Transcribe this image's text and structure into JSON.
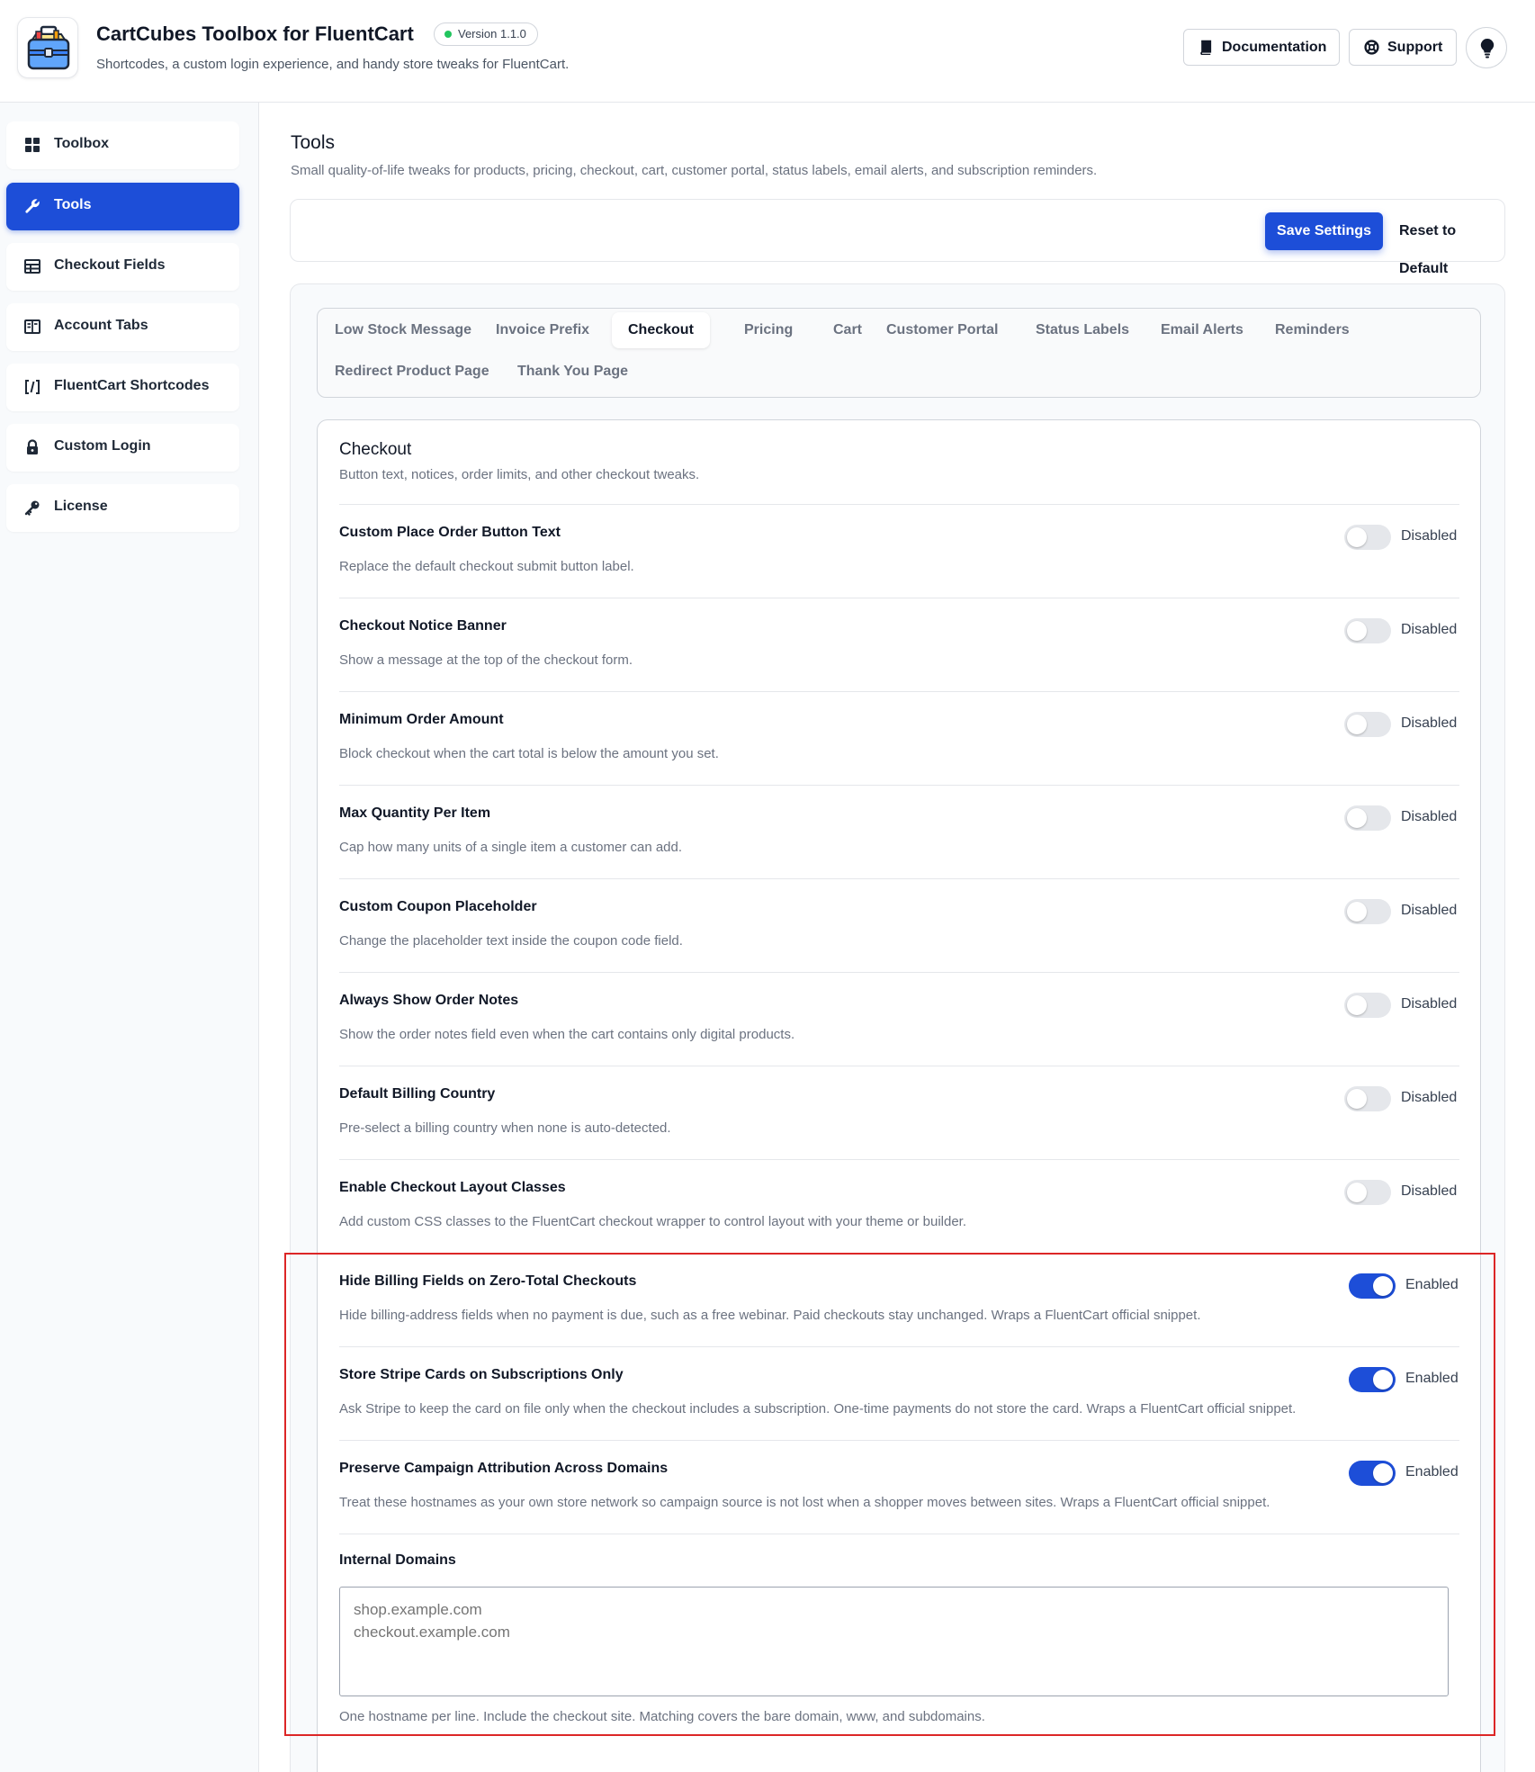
{
  "header": {
    "title": "CartCubes Toolbox for FluentCart",
    "version": "Version 1.1.0",
    "subtitle": "Shortcodes, a custom login experience, and handy store tweaks for FluentCart.",
    "documentation_label": "Documentation",
    "support_label": "Support",
    "colors": {
      "accent": "#1d4ed8",
      "version_dot": "#22c55e"
    }
  },
  "sidebar": {
    "items": [
      {
        "label": "Toolbox",
        "icon": "grid-icon"
      },
      {
        "label": "Tools",
        "icon": "wrench-icon",
        "active": true
      },
      {
        "label": "Checkout Fields",
        "icon": "table-icon"
      },
      {
        "label": "Account Tabs",
        "icon": "columns-icon"
      },
      {
        "label": "FluentCart Shortcodes",
        "icon": "code-brackets-icon"
      },
      {
        "label": "Custom Login",
        "icon": "lock-icon"
      },
      {
        "label": "License",
        "icon": "key-icon"
      }
    ]
  },
  "main": {
    "title": "Tools",
    "subtitle": "Small quality-of-life tweaks for products, pricing, checkout, cart, customer portal, status labels, email alerts, and subscription reminders.",
    "save_label": "Save Settings",
    "reset_label": "Reset to Default",
    "tabs": [
      "Low Stock Message",
      "Invoice Prefix",
      "Checkout",
      "Pricing",
      "Cart",
      "Customer Portal",
      "Status Labels",
      "Email Alerts",
      "Reminders",
      "Redirect Product Page",
      "Thank You Page"
    ],
    "active_tab": "Checkout"
  },
  "section": {
    "title": "Checkout",
    "subtitle": "Button text, notices, order limits, and other checkout tweaks.",
    "rows": [
      {
        "title": "Custom Place Order Button Text",
        "desc": "Replace the default checkout submit button label.",
        "state": "Disabled",
        "enabled": false
      },
      {
        "title": "Checkout Notice Banner",
        "desc": "Show a message at the top of the checkout form.",
        "state": "Disabled",
        "enabled": false
      },
      {
        "title": "Minimum Order Amount",
        "desc": "Block checkout when the cart total is below the amount you set.",
        "state": "Disabled",
        "enabled": false
      },
      {
        "title": "Max Quantity Per Item",
        "desc": "Cap how many units of a single item a customer can add.",
        "state": "Disabled",
        "enabled": false
      },
      {
        "title": "Custom Coupon Placeholder",
        "desc": "Change the placeholder text inside the coupon code field.",
        "state": "Disabled",
        "enabled": false
      },
      {
        "title": "Always Show Order Notes",
        "desc": "Show the order notes field even when the cart contains only digital products.",
        "state": "Disabled",
        "enabled": false
      },
      {
        "title": "Default Billing Country",
        "desc": "Pre-select a billing country when none is auto-detected.",
        "state": "Disabled",
        "enabled": false
      },
      {
        "title": "Enable Checkout Layout Classes",
        "desc": "Add custom CSS classes to the FluentCart checkout wrapper to control layout with your theme or builder.",
        "state": "Disabled",
        "enabled": false
      },
      {
        "title": "Hide Billing Fields on Zero-Total Checkouts",
        "desc": "Hide billing-address fields when no payment is due, such as a free webinar. Paid checkouts stay unchanged. Wraps a FluentCart official snippet.",
        "state": "Enabled",
        "enabled": true
      },
      {
        "title": "Store Stripe Cards on Subscriptions Only",
        "desc": "Ask Stripe to keep the card on file only when the checkout includes a subscription. One-time payments do not store the card. Wraps a FluentCart official snippet.",
        "state": "Enabled",
        "enabled": true
      },
      {
        "title": "Preserve Campaign Attribution Across Domains",
        "desc": "Treat these hostnames as your own store network so campaign source is not lost when a shopper moves between sites. Wraps a FluentCart official snippet.",
        "state": "Enabled",
        "enabled": true
      }
    ],
    "internal_domains": {
      "label": "Internal Domains",
      "placeholder": "shop.example.com\ncheckout.example.com",
      "help": "One hostname per line. Include the checkout site. Matching covers the bare domain, www, and subdomains."
    }
  }
}
